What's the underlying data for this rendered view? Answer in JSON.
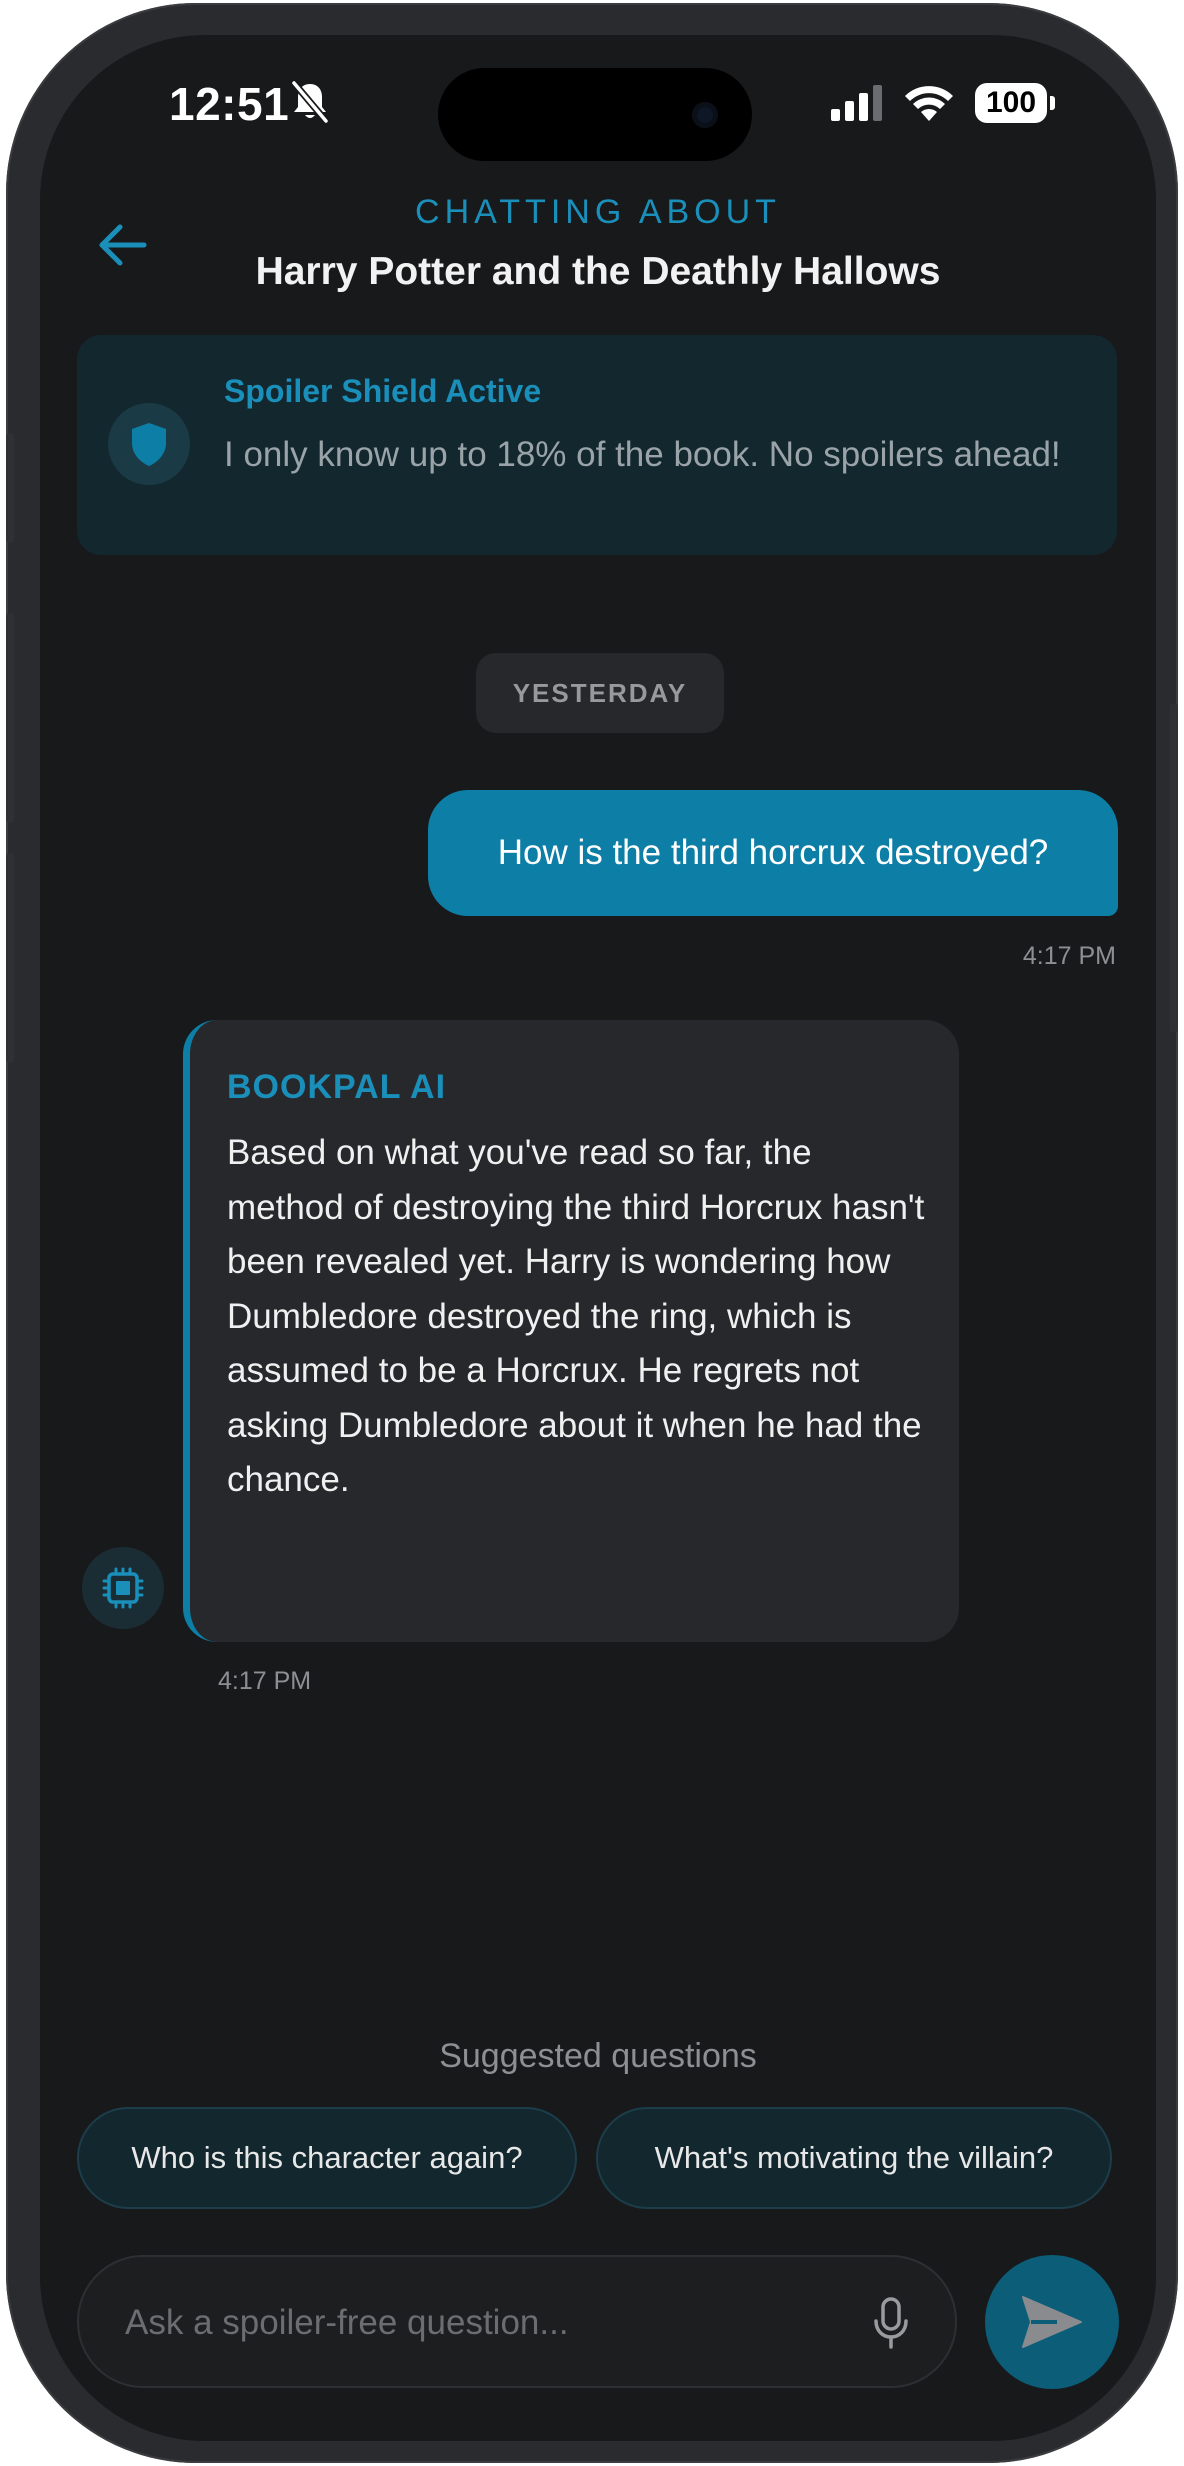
{
  "status_bar": {
    "time": "12:51",
    "battery": "100",
    "icons": [
      "bell-slash-icon",
      "cellular-signal-icon",
      "wifi-icon",
      "battery-icon"
    ]
  },
  "header": {
    "eyebrow": "CHATTING ABOUT",
    "title": "Harry Potter and the Deathly Hallows",
    "back_icon": "arrow-left-icon"
  },
  "spoiler_shield": {
    "title": "Spoiler Shield Active",
    "text": "I only know up to 18% of the book. No spoilers ahead!",
    "icon": "shield-icon"
  },
  "date_divider": "YESTERDAY",
  "messages": [
    {
      "role": "user",
      "text": "How is the third horcrux destroyed?",
      "time": "4:17 PM"
    },
    {
      "role": "assistant",
      "sender": "BOOKPAL AI",
      "text": "Based on what you've read so far, the method of destroying the third Horcrux hasn't been revealed yet. Harry is wondering how Dumbledore destroyed the ring, which is assumed to be a Horcrux. He regrets not asking Dumbledore about it when he had the chance.",
      "time": "4:17 PM",
      "avatar_icon": "chip-icon"
    }
  ],
  "suggestions": {
    "label": "Suggested questions",
    "items": [
      "Who is this character again?",
      "What's motivating the villain?"
    ]
  },
  "composer": {
    "placeholder": "Ask a spoiler-free question...",
    "value": "",
    "mic_icon": "microphone-icon",
    "send_icon": "send-icon"
  },
  "colors": {
    "accent": "#1a8fba",
    "user_bubble": "#0d7fa6",
    "background": "#18191b",
    "card": "#27282b",
    "shield_card": "#13272f"
  }
}
